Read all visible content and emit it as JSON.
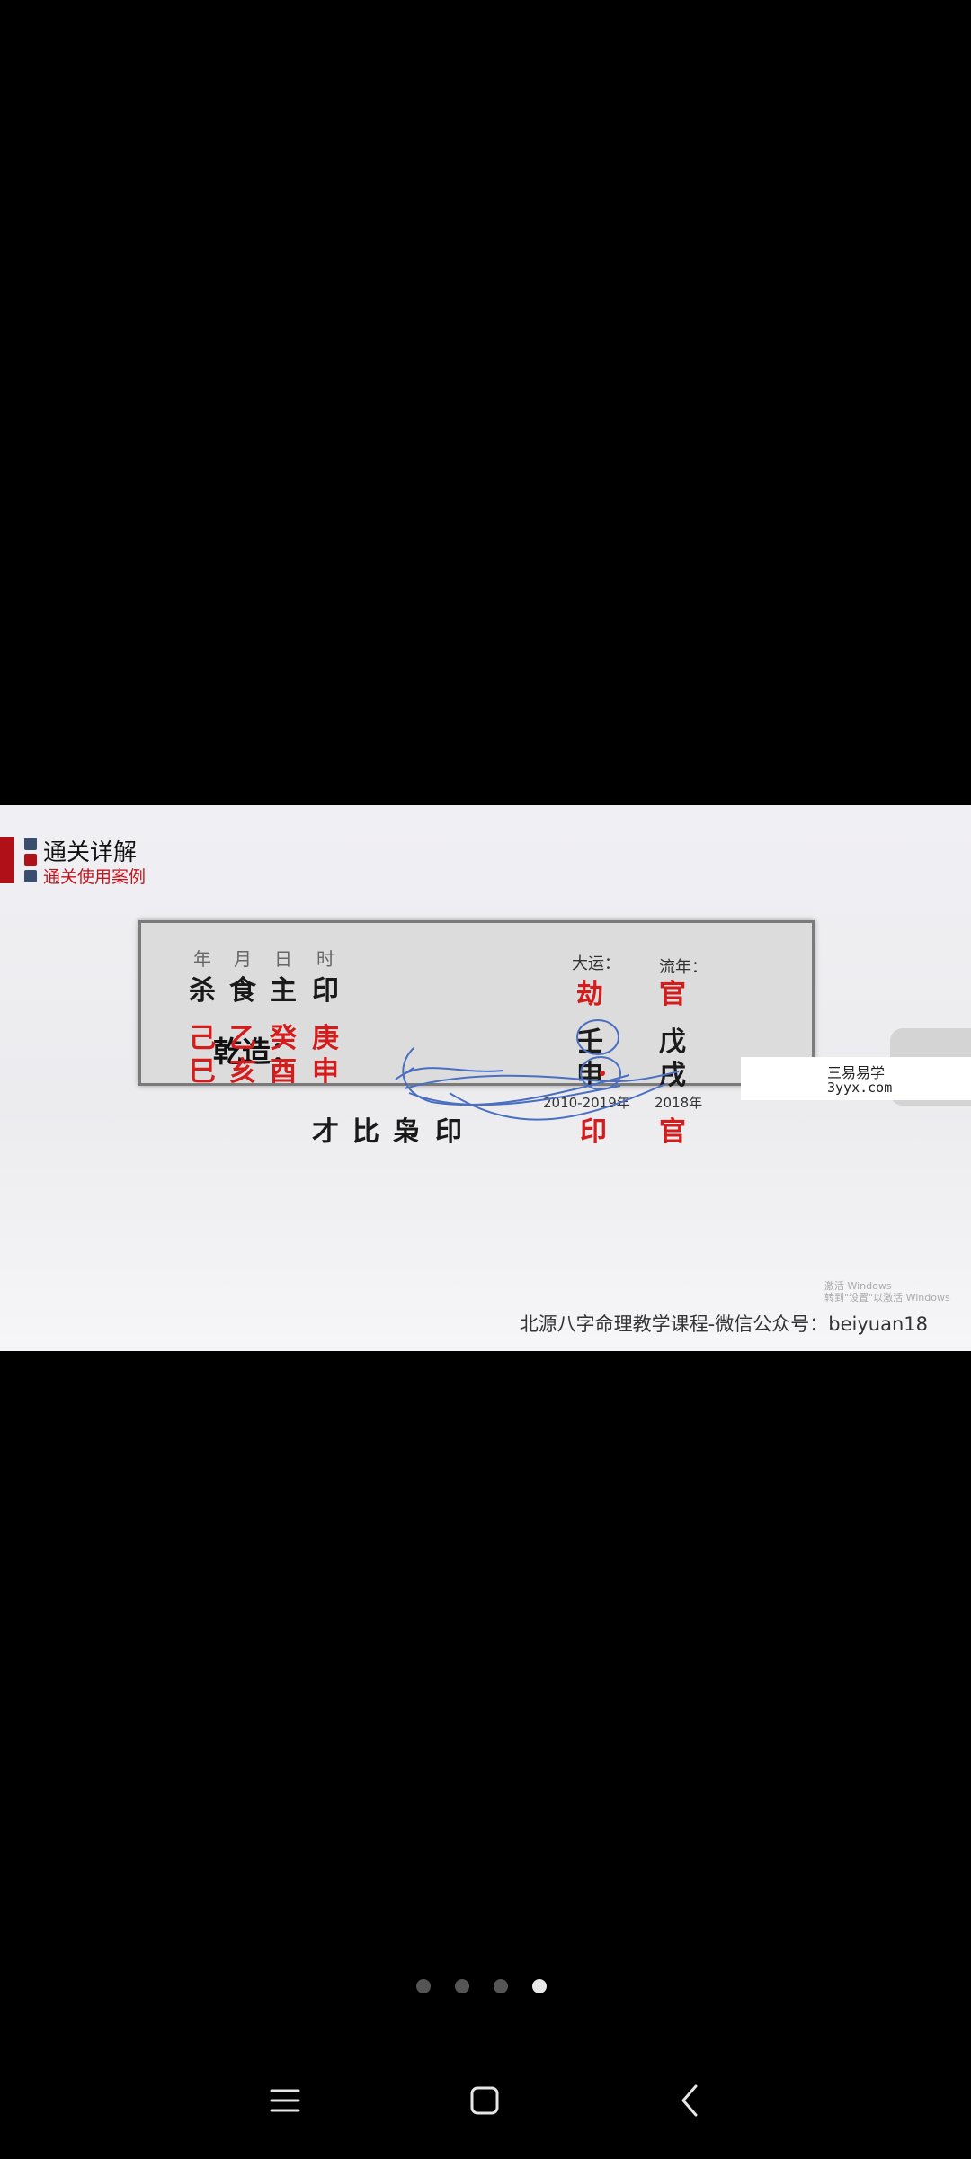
{
  "slide": {
    "title": "通关详解",
    "subtitle": "通关使用案例",
    "footer": "北源八字命理教学课程-微信公众号：beiyuan18",
    "activate_line1": "激活 Windows",
    "activate_line2": "转到\"设置\"以激活 Windows"
  },
  "chart": {
    "label": "乾造：",
    "headers": [
      "年",
      "月",
      "日",
      "时"
    ],
    "top_gods": [
      "杀",
      "食",
      "主",
      "印"
    ],
    "stems": [
      "己",
      "乙",
      "癸",
      "庚"
    ],
    "branches": [
      "巳",
      "亥",
      "酉",
      "申"
    ],
    "bottom_gods": [
      "才",
      "比",
      "枭",
      "印"
    ],
    "dayun": {
      "label": "大运：",
      "top": "劫",
      "stem": "壬",
      "branch": "申",
      "bottom": "印",
      "years": "2010-2019年"
    },
    "liunian": {
      "label": "流年：",
      "top": "官",
      "stem": "戊",
      "branch": "戌",
      "bottom": "官",
      "year": "2018年"
    }
  },
  "watermark": {
    "line1": "三易易学",
    "line2": "3yyx.com"
  },
  "pager": {
    "total": 4,
    "active_index": 3
  },
  "colors": {
    "accent_red": "#d41c1c",
    "annotation_blue": "#4a6fc0"
  }
}
